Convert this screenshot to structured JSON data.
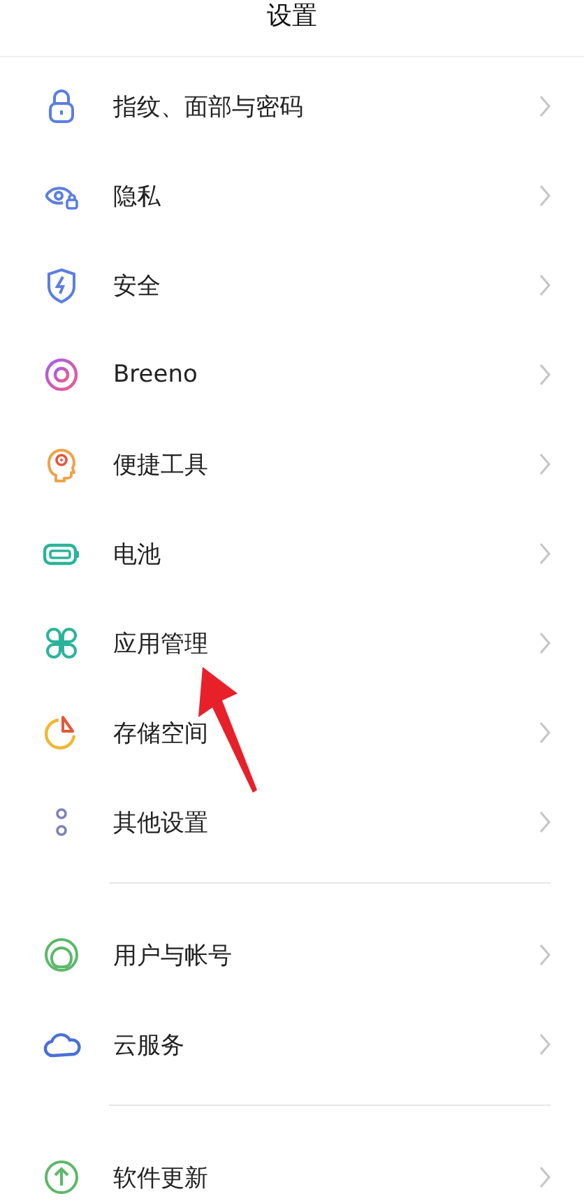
{
  "header": {
    "title": "设置"
  },
  "sections": [
    {
      "items": [
        {
          "label": "指纹、面部与密码"
        },
        {
          "label": "隐私"
        },
        {
          "label": "安全"
        },
        {
          "label": "Breeno"
        },
        {
          "label": "便捷工具"
        },
        {
          "label": "电池"
        },
        {
          "label": "应用管理"
        },
        {
          "label": "存储空间"
        },
        {
          "label": "其他设置"
        }
      ]
    },
    {
      "items": [
        {
          "label": "用户与帐号"
        },
        {
          "label": "云服务"
        }
      ]
    },
    {
      "items": [
        {
          "label": "软件更新"
        }
      ]
    }
  ],
  "annotations": [
    {
      "kind": "arrow"
    }
  ]
}
